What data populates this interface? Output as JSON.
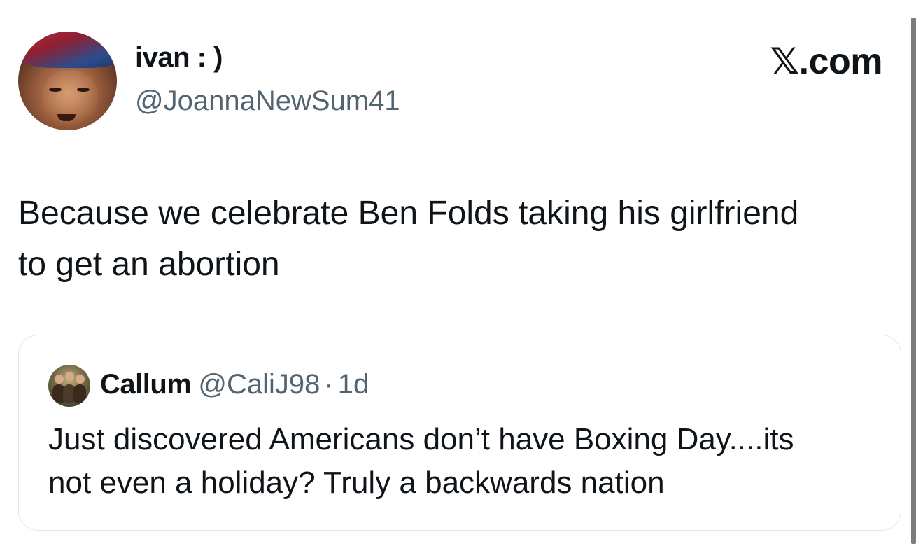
{
  "tweet": {
    "author": {
      "display_name": "ivan : )",
      "handle": "@JoannaNewSum41",
      "avatar_icon": "profile-photo"
    },
    "source_label": "𝕏.com",
    "text_lines": [
      "Because we celebrate Ben Folds taking his girlfriend",
      "to get an abortion"
    ]
  },
  "quoted_tweet": {
    "author": {
      "display_name": "Callum",
      "handle": "@CaliJ98",
      "separator": "·",
      "time": "1d",
      "avatar_icon": "profile-photo"
    },
    "text_lines": [
      "Just discovered Americans don’t have Boxing Day....its",
      "not even a holiday? Truly a backwards nation"
    ]
  },
  "colors": {
    "text_primary": "#0f1419",
    "text_secondary": "#536471",
    "card_border": "#e3e6ea"
  }
}
